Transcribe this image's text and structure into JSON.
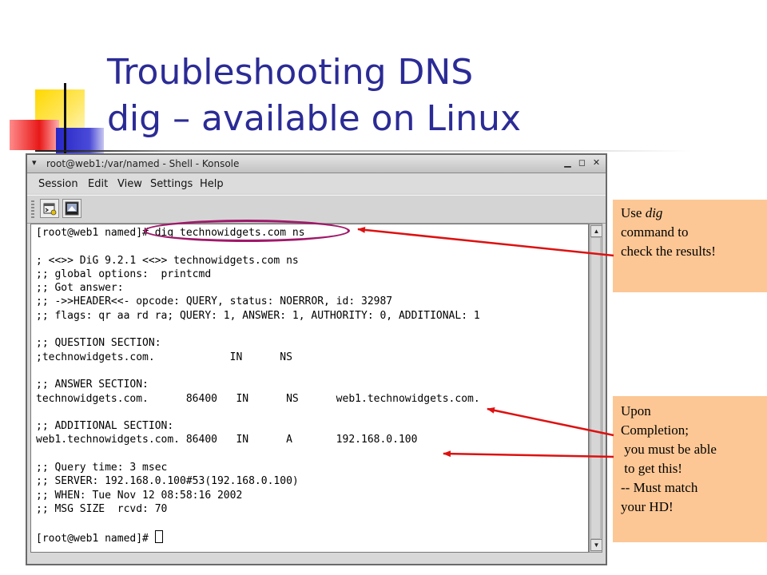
{
  "slide": {
    "title_line1": "Troubleshooting DNS",
    "title_line2": "dig – available on Linux"
  },
  "window": {
    "title": "root@web1:/var/named - Shell - Konsole",
    "controls": {
      "minimize": "▁",
      "maximize": "◻",
      "close": "✕"
    },
    "menu": [
      "Session",
      "Edit",
      "View",
      "Settings",
      "Help"
    ],
    "toolbar": [
      "new-session-icon",
      "konsole-icon"
    ]
  },
  "terminal": {
    "lines": [
      "[root@web1 named]# dig technowidgets.com ns",
      "",
      "; <<>> DiG 9.2.1 <<>> technowidgets.com ns",
      ";; global options:  printcmd",
      ";; Got answer:",
      ";; ->>HEADER<<- opcode: QUERY, status: NOERROR, id: 32987",
      ";; flags: qr aa rd ra; QUERY: 1, ANSWER: 1, AUTHORITY: 0, ADDITIONAL: 1",
      "",
      ";; QUESTION SECTION:",
      ";technowidgets.com.            IN      NS",
      "",
      ";; ANSWER SECTION:",
      "technowidgets.com.      86400   IN      NS      web1.technowidgets.com.",
      "",
      ";; ADDITIONAL SECTION:",
      "web1.technowidgets.com. 86400   IN      A       192.168.0.100",
      "",
      ";; Query time: 3 msec",
      ";; SERVER: 192.168.0.100#53(192.168.0.100)",
      ";; WHEN: Tue Nov 12 08:58:16 2002",
      ";; MSG SIZE  rcvd: 70",
      ""
    ],
    "prompt": "[root@web1 named]# "
  },
  "callouts": {
    "first": {
      "prefix": "Use ",
      "italic": "dig",
      "rest": "\ncommand to\ncheck the results!"
    },
    "second": {
      "text": "Upon\nCompletion;\n you must be able\n to get this!\n-- Must match\nyour HD!"
    }
  },
  "colors": {
    "title": "#2b2b96",
    "callout_bg": "#fcc795",
    "arrow": "#dd1111",
    "ellipse": "#a0186a"
  }
}
